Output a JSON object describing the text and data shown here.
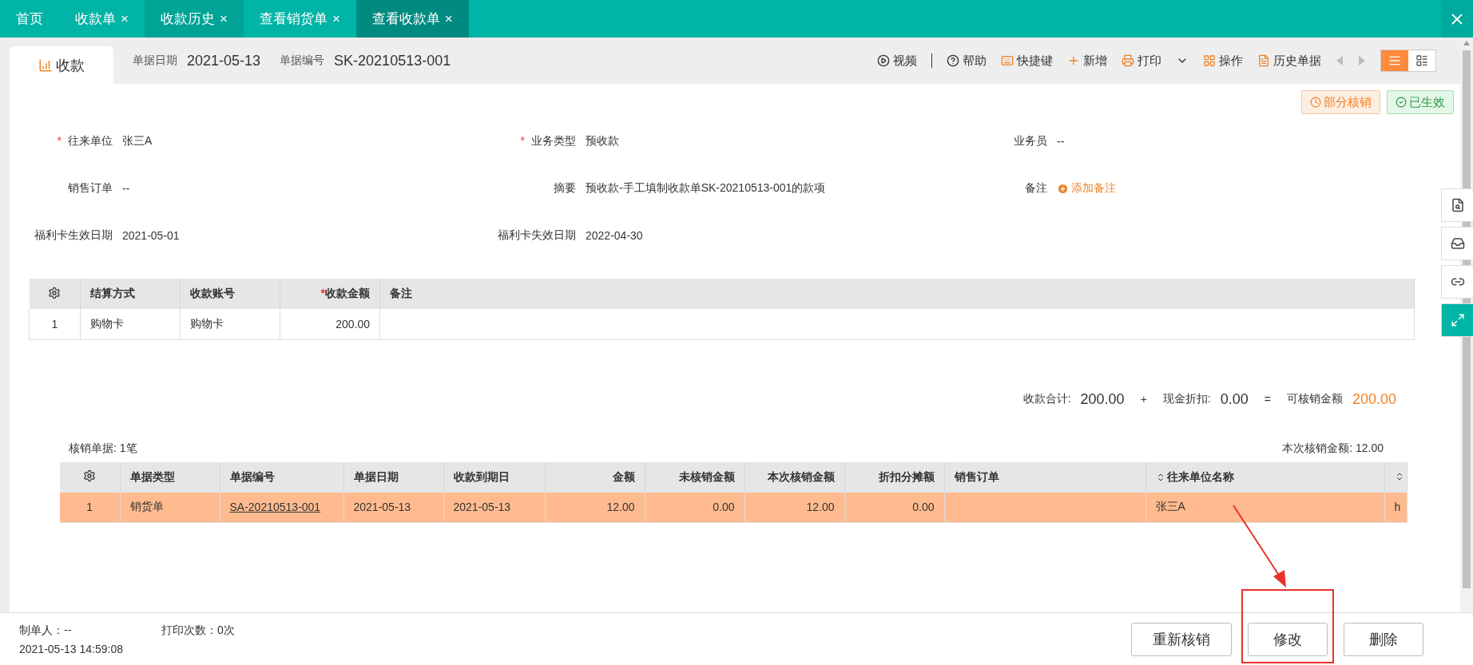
{
  "tabs": [
    {
      "label": "首页",
      "selected": false,
      "hovered": false
    },
    {
      "label": "收款单",
      "selected": false,
      "hovered": false,
      "close": "×"
    },
    {
      "label": "收款历史",
      "selected": false,
      "hovered": true,
      "close": "×"
    },
    {
      "label": "查看销货单",
      "selected": false,
      "hovered": false,
      "close": "×"
    },
    {
      "label": "查看收款单",
      "selected": true,
      "hovered": false,
      "close": "×"
    }
  ],
  "header": {
    "doc_tab": "收款",
    "date_label": "单据日期",
    "date": "2021-05-13",
    "number_label": "单据编号",
    "number": "SK-20210513-001"
  },
  "toolbar": [
    {
      "kind": "video",
      "label": "视频"
    },
    {
      "kind": "help",
      "label": "帮助"
    },
    {
      "kind": "shortcut",
      "label": "快捷键"
    },
    {
      "kind": "add",
      "label": "新增"
    },
    {
      "kind": "print",
      "label": "打印"
    },
    {
      "kind": "operate",
      "label": "操作"
    },
    {
      "kind": "history",
      "label": "历史单据"
    }
  ],
  "view_toggle": [
    {
      "kind": "list",
      "selected": true
    },
    {
      "kind": "detail",
      "selected": false
    }
  ],
  "status_badges": [
    {
      "kind": "partial",
      "label": "部分核销"
    },
    {
      "kind": "effective",
      "label": "已生效"
    }
  ],
  "fields": [
    {
      "mark": "*",
      "label": "往来单位",
      "value": "张三A",
      "kind": "text"
    },
    {
      "mark": "*",
      "label": "业务类型",
      "value": "预收款",
      "kind": "text"
    },
    {
      "label": "业务员",
      "value": "--",
      "kind": "text"
    },
    {
      "label": "销售订单",
      "value": "--",
      "kind": "text"
    },
    {
      "label": "摘要",
      "value": "预收款-手工填制收款单SK-20210513-001的款项",
      "kind": "text"
    },
    {
      "label": "备注",
      "value": "添加备注",
      "kind": "add"
    },
    {
      "label": "福利卡生效日期",
      "value": "2021-05-01",
      "kind": "text"
    },
    {
      "label": "福利卡失效日期",
      "value": "2022-04-30",
      "kind": "text"
    }
  ],
  "settlement_table": {
    "columns": [
      {
        "label": "结算方式",
        "kind": "text"
      },
      {
        "label": "收款账号",
        "kind": "text"
      },
      {
        "mark": "*",
        "label": "收款金额",
        "kind": "amount"
      },
      {
        "label": "备注",
        "kind": "text"
      }
    ],
    "rows": [
      {
        "index": "1",
        "cells": [
          "购物卡",
          "购物卡",
          "200.00",
          ""
        ]
      }
    ]
  },
  "totals": [
    {
      "label": "收款合计:",
      "value": "200.00",
      "op": "+",
      "highlight": false
    },
    {
      "label": "现金折扣:",
      "value": "0.00",
      "op": "=",
      "highlight": false
    },
    {
      "label": "可核销金额",
      "value": "200.00",
      "highlight": true
    }
  ],
  "writeoff": {
    "count_label": "核销单据: 1笔",
    "amount_label": "本次核销金额: 12.00",
    "columns": [
      {
        "label": "单据类型",
        "kind": "text",
        "sortable": false
      },
      {
        "label": "单据编号",
        "kind": "link",
        "sortable": false
      },
      {
        "label": "单据日期",
        "kind": "text",
        "sortable": false
      },
      {
        "label": "收款到期日",
        "kind": "text",
        "sortable": false
      },
      {
        "label": "金额",
        "kind": "amount",
        "sortable": false
      },
      {
        "label": "未核销金额",
        "kind": "amount",
        "sortable": false
      },
      {
        "label": "本次核销金额",
        "kind": "amount",
        "sortable": false
      },
      {
        "label": "折扣分摊额",
        "kind": "amount",
        "sortable": false
      },
      {
        "label": "销售订单",
        "kind": "text",
        "sortable": false
      },
      {
        "label": "往来单位名称",
        "kind": "text",
        "sortable": true
      },
      {
        "kind": "text",
        "sortable": true
      }
    ],
    "rows": [
      {
        "index": "1",
        "selected": true,
        "cells": [
          "销货单",
          "SA-20210513-001",
          "2021-05-13",
          "2021-05-13",
          "12.00",
          "0.00",
          "12.00",
          "0.00",
          "",
          "张三A",
          "h"
        ]
      }
    ]
  },
  "footer": {
    "creator": "制单人：--",
    "print_count": "打印次数：0次",
    "timestamp": "2021-05-13 14:59:08",
    "buttons": [
      {
        "label": "重新核销",
        "highlighted": false
      },
      {
        "label": "修改",
        "highlighted": true
      },
      {
        "label": "删除",
        "highlighted": false
      }
    ]
  }
}
